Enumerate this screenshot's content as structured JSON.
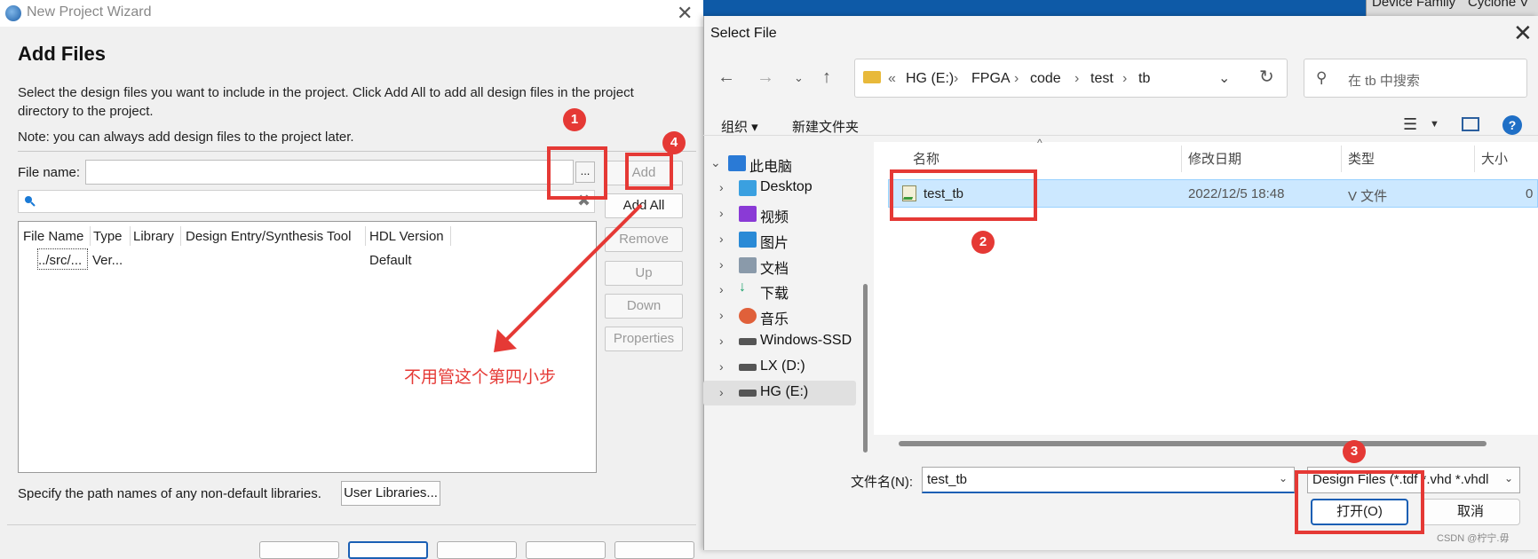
{
  "background_app": {
    "device_family_label": "Device Family",
    "device_value": "Cyclone V"
  },
  "wizard": {
    "title": "New Project Wizard",
    "heading": "Add Files",
    "desc_line1": "Select the design files you want to include in the project. Click Add All to add all design files in the project",
    "desc_line2": "directory to the project.",
    "note": "Note: you can always add design files to the project later.",
    "file_name_label": "File name:",
    "file_name_value": "",
    "browse_label": "...",
    "buttons": {
      "add": "Add",
      "add_all": "Add All",
      "remove": "Remove",
      "up": "Up",
      "down": "Down",
      "properties": "Properties"
    },
    "table": {
      "columns": [
        "File Name",
        "Type",
        "Library",
        "Design Entry/Synthesis Tool",
        "HDL Version"
      ],
      "rows": [
        {
          "file_name": "../src/...",
          "type": "Ver...",
          "library": "",
          "tool": "",
          "hdl_version": "Default"
        }
      ]
    },
    "lib_text": "Specify the path names of any non-default libraries.",
    "user_libraries_label": "User Libraries..."
  },
  "dialog": {
    "title": "Select File",
    "breadcrumb": [
      "«",
      "HG (E:)",
      "FPGA",
      "code",
      "test",
      "tb"
    ],
    "search_placeholder": "在 tb 中搜索",
    "organize_label": "组织",
    "new_folder_label": "新建文件夹",
    "tree": [
      {
        "label": "此电脑",
        "icon": "computer-icon",
        "color": "#2a7ad6"
      },
      {
        "label": "Desktop",
        "icon": "desktop-icon",
        "color": "#3aa0e0"
      },
      {
        "label": "视频",
        "icon": "video-icon",
        "color": "#8a3ad6"
      },
      {
        "label": "图片",
        "icon": "pictures-icon",
        "color": "#2a8ad6"
      },
      {
        "label": "文档",
        "icon": "documents-icon",
        "color": "#6a7a8a"
      },
      {
        "label": "下载",
        "icon": "download-icon",
        "color": "#1aa06a"
      },
      {
        "label": "音乐",
        "icon": "music-icon",
        "color": "#e0603a"
      },
      {
        "label": "Windows-SSD",
        "icon": "drive-icon",
        "color": "#555555"
      },
      {
        "label": "LX (D:)",
        "icon": "drive-icon",
        "color": "#555555"
      },
      {
        "label": "HG (E:)",
        "icon": "drive-icon",
        "color": "#555555"
      }
    ],
    "columns": {
      "name": "名称",
      "modified": "修改日期",
      "type": "类型",
      "size": "大小"
    },
    "files": [
      {
        "name": "test_tb",
        "modified": "2022/12/5 18:48",
        "type": "V 文件",
        "size": "0"
      }
    ],
    "filename_label": "文件名(N):",
    "filename_value": "test_tb",
    "filter_value": "Design Files (*.tdf *.vhd *.vhdl",
    "open_label": "打开(O)",
    "cancel_label": "取消",
    "watermark": "CSDN @柠宁.毋"
  },
  "annotations": {
    "badges": [
      "1",
      "2",
      "3",
      "4"
    ],
    "note_text": "不用管这个第四小步",
    "color": "#e53935"
  }
}
